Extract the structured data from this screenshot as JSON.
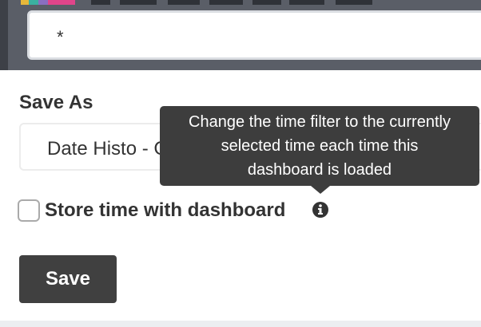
{
  "query": {
    "text": "*"
  },
  "save_as": {
    "label": "Save As",
    "value": "Date Histo - Count"
  },
  "store_time": {
    "label": "Store time with dashboard",
    "checked": false,
    "icon": "info-circle-icon"
  },
  "tooltip": {
    "line1": "Change the time filter to the currently",
    "line2": "selected time each time this",
    "line3": "dashboard is loaded"
  },
  "save_button": {
    "label": "Save"
  },
  "colors": {
    "top_bar": "#5a5e67",
    "tooltip_bg": "#3d3d3d",
    "button_bg": "#404040",
    "text": "#333333"
  }
}
